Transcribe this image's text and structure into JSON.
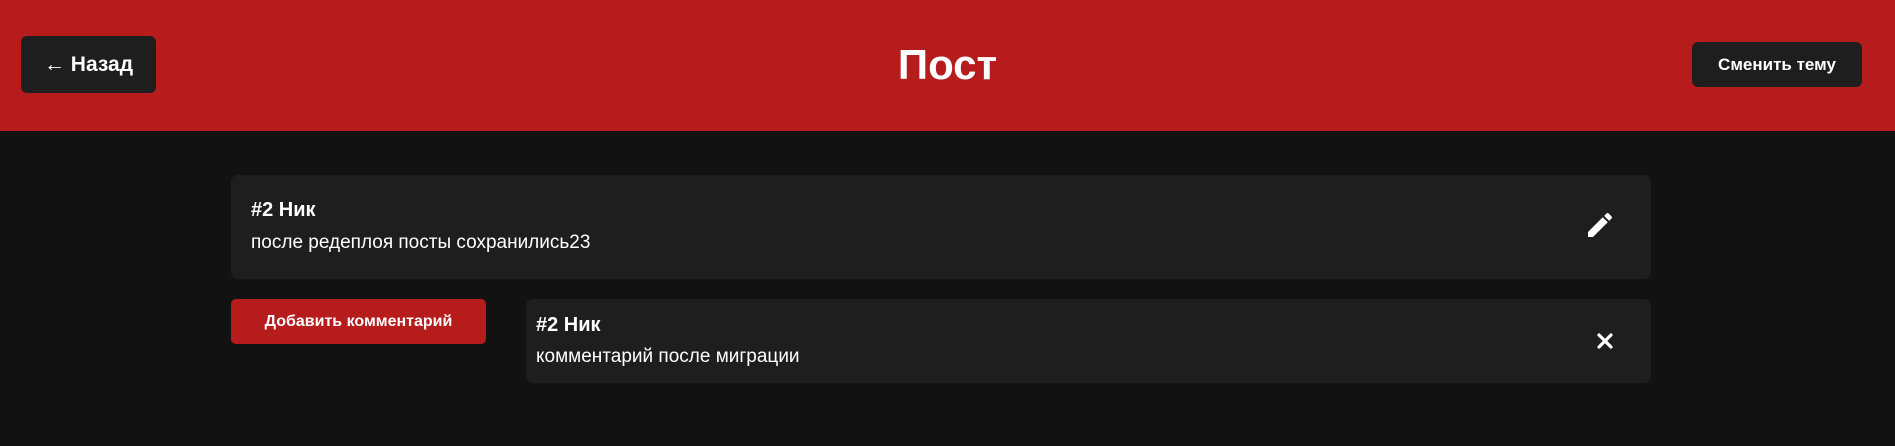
{
  "header": {
    "back_label": "← Назад",
    "title": "Пост",
    "theme_label": "Сменить тему",
    "background_color": "#b71c1c"
  },
  "post": {
    "author": "#2 Ник",
    "text": "после редеплоя посты сохранились23",
    "edit_icon": "pencil-icon"
  },
  "comments_section": {
    "add_comment_label": "Добавить комментарий",
    "comments": [
      {
        "author": "#2 Ник",
        "text": "комментарий после миграции",
        "delete_icon": "close-icon"
      }
    ]
  },
  "colors": {
    "page_background": "#121212",
    "card_background": "#1e1e1e",
    "accent": "#b71c1c",
    "text": "#ffffff"
  }
}
